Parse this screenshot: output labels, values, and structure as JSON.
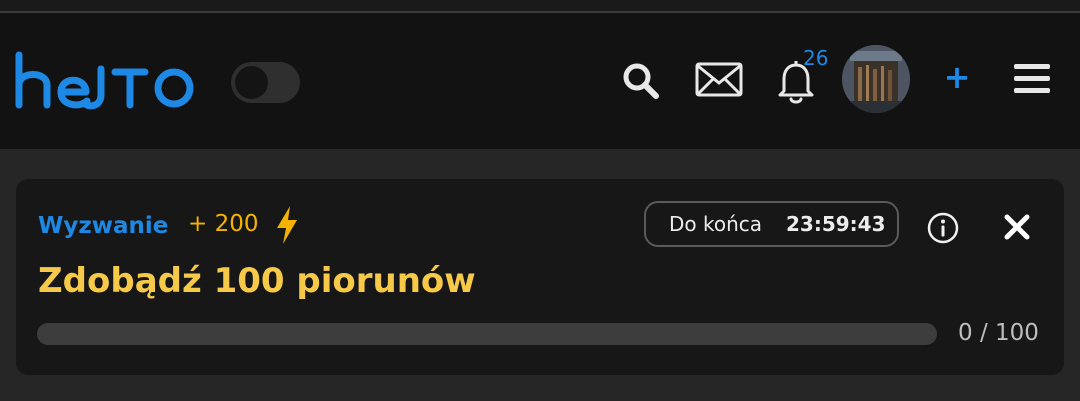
{
  "header": {
    "logo_text": "hejto",
    "notifications_count": "26",
    "add_label": "+"
  },
  "challenge": {
    "label": "Wyzwanie",
    "points": "+ 200",
    "timer_label": "Do końca",
    "timer_value": "23:59:43",
    "title": "Zdobądź 100 piorunów",
    "progress_text": "0 / 100",
    "progress_fraction": 0.0
  },
  "colors": {
    "brand_blue": "#1e88e5",
    "accent_gold": "#f5b301",
    "title_gold": "#f7c948",
    "header_bg": "#121212",
    "card_bg": "#171717",
    "page_bg": "#262626"
  },
  "icons": {
    "search": "search-icon",
    "mail": "mail-icon",
    "bell": "bell-icon",
    "menu": "hamburger-menu-icon",
    "bolt": "lightning-bolt-icon",
    "info": "info-icon",
    "close": "close-icon"
  }
}
